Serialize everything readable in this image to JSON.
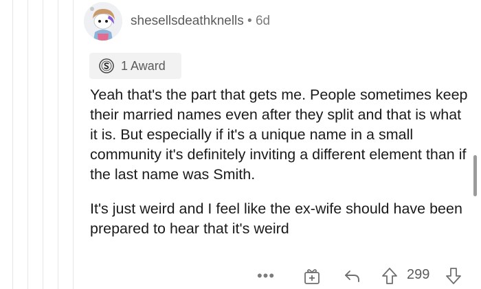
{
  "comment": {
    "author": "shesellsdeathknells",
    "separator": "•",
    "age": "6d",
    "award_label": "1 Award",
    "paragraphs": [
      "Yeah that's the part that gets me. People sometimes keep their married names even after they split and that is what it is. But especially if it's a unique name in a small community it's definitely inviting a different element than if the last name was Smith.",
      "It's just weird and I feel like the ex-wife should have been prepared to hear that it's weird"
    ]
  },
  "actions": {
    "more_label": "•••",
    "score": "299"
  },
  "icons": {
    "avatar": "snoo-avatar-icon",
    "award": "silver-award-icon",
    "more": "more-options-icon",
    "gift": "gift-award-icon",
    "reply": "reply-arrow-icon",
    "upvote": "upvote-arrow-icon",
    "downvote": "downvote-arrow-icon"
  },
  "colors": {
    "text": "#1a1a1b",
    "meta": "#7c7c7c",
    "thread_line": "#e6e6e6",
    "award_bg": "#f2f2f2"
  }
}
